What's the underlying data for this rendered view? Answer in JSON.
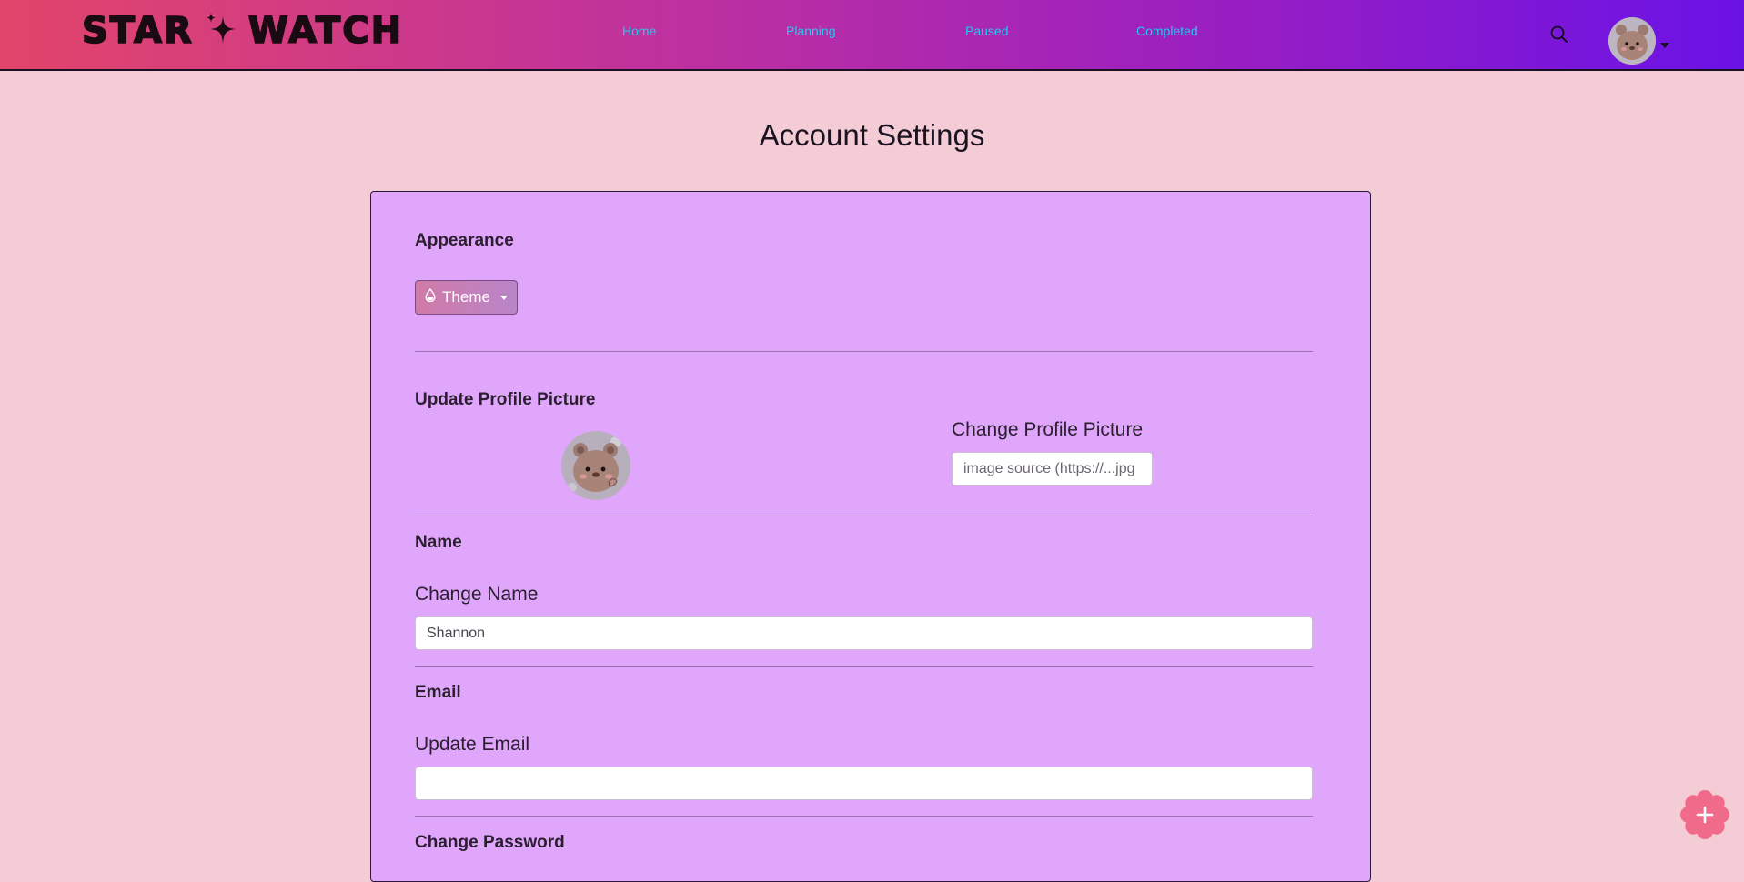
{
  "brand": {
    "word_left": "STAR",
    "word_right": "WATCH"
  },
  "nav": {
    "home": "Home",
    "planning": "Planning",
    "paused": "Paused",
    "completed": "Completed"
  },
  "page": {
    "title": "Account Settings"
  },
  "appearance": {
    "title": "Appearance",
    "theme_label": "Theme"
  },
  "profile_picture": {
    "title": "Update Profile Picture",
    "change_label": "Change Profile Picture",
    "source_placeholder": "image source (https://...jpg"
  },
  "name": {
    "title": "Name",
    "change_label": "Change Name",
    "value": "Shannon"
  },
  "email": {
    "title": "Email",
    "update_label": "Update Email",
    "value": ""
  },
  "password": {
    "title": "Change Password"
  },
  "colors": {
    "nav_gradient_start": "#e2456a",
    "nav_gradient_end": "#6a12e6",
    "nav_link": "#27c7ee",
    "page_bg": "#f4ccd5",
    "card_bg": "#e0a6fb",
    "fab": "#f06b8a"
  },
  "icons": {
    "brand_star": "sparkle-star-icon",
    "search": "search-icon",
    "theme": "droplet-icon",
    "fab": "plus-icon"
  }
}
